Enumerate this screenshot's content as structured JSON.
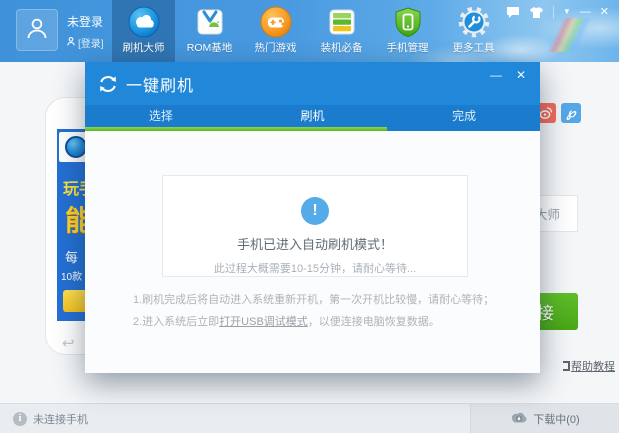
{
  "topbar": {
    "user": {
      "name": "未登录",
      "login": "[登录]"
    },
    "nav": [
      {
        "label": "刷机大师",
        "icon": "cloud-icon",
        "active": true
      },
      {
        "label": "ROM基地",
        "icon": "rom-store-icon",
        "active": false
      },
      {
        "label": "热门游戏",
        "icon": "games-icon",
        "active": false
      },
      {
        "label": "装机必备",
        "icon": "essential-apps-icon",
        "active": false
      },
      {
        "label": "手机管理",
        "icon": "phone-manager-icon",
        "active": false
      },
      {
        "label": "更多工具",
        "icon": "more-tools-icon",
        "active": false
      }
    ],
    "controls": {
      "dropdown": "▼",
      "minimize": "—",
      "close": "✕"
    }
  },
  "dialog": {
    "title": "一键刷机",
    "controls": {
      "minimize": "—",
      "close": "✕"
    },
    "tabs": [
      {
        "label": "选择",
        "active": false
      },
      {
        "label": "刷机",
        "active": true
      },
      {
        "label": "完成",
        "active": false
      }
    ],
    "progress_percent": 66,
    "status": {
      "icon": "!",
      "title": "手机已进入自动刷机模式！",
      "subtitle": "此过程大概需要10-15分钟，请耐心等待..."
    },
    "notes": {
      "line1": "1.刷机完成后将自动进入系统重新开机，第一次开机比较慢，请耐心等待；",
      "line2_prefix": "2.进入系统后立即",
      "line2_link": "打开USB调试模式",
      "line2_suffix": "，以便连接电脑恢复数据。"
    }
  },
  "background_page": {
    "banner": {
      "text1": "玩手",
      "text2": "能",
      "text3": "每",
      "text4": "10款"
    },
    "phone_back_glyph": "↩",
    "device_box_text": "大师",
    "connect_button_text": "接",
    "help_link_text": "帮助教程"
  },
  "statusbar": {
    "info_glyph": "i",
    "connection": "未连接手机",
    "download": "下载中(0)"
  },
  "colors": {
    "topbar_blue": "#4899e0",
    "dialog_header_blue": "#2187d8",
    "tab_bar_blue": "#1b7ccd",
    "progress_green": "#5fb71d",
    "alert_circle_blue": "#55aae8",
    "connect_green": "#4ead1c",
    "banner_blue": "#2470d4",
    "banner_yellow": "#ffd230"
  }
}
